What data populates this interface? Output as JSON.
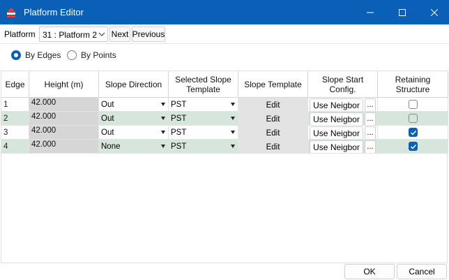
{
  "window": {
    "title": "Platform Editor",
    "accent": "#0a5fb6"
  },
  "toolbar": {
    "platform_label": "Platform",
    "platform_value": "31 : Platform 2",
    "next_label": "Next",
    "previous_label": "Previous"
  },
  "mode": {
    "by_edges_label": "By Edges",
    "by_points_label": "By Points",
    "selected": "By Edges"
  },
  "grid": {
    "headers": {
      "edge": "Edge",
      "height": "Height (m)",
      "slope_direction": "Slope Direction",
      "selected_template": "Selected Slope Template",
      "slope_template": "Slope Template",
      "slope_start": "Slope Start Config.",
      "retaining": "Retaining Structure"
    },
    "rows": [
      {
        "edge": "1",
        "height": "42.000",
        "direction": "Out",
        "template": "PST",
        "edit": "Edit",
        "start": "Use Neigbor",
        "dots": "...",
        "retaining": false
      },
      {
        "edge": "2",
        "height": "42.000",
        "direction": "Out",
        "template": "PST",
        "edit": "Edit",
        "start": "Use Neigbor",
        "dots": "...",
        "retaining": false
      },
      {
        "edge": "3",
        "height": "42.000",
        "direction": "Out",
        "template": "PST",
        "edit": "Edit",
        "start": "Use Neigbor",
        "dots": "...",
        "retaining": true
      },
      {
        "edge": "4",
        "height": "42.000",
        "direction": "None",
        "template": "PST",
        "edit": "Edit",
        "start": "Use Neigbor",
        "dots": "...",
        "retaining": true
      }
    ]
  },
  "footer": {
    "ok_label": "OK",
    "cancel_label": "Cancel"
  }
}
